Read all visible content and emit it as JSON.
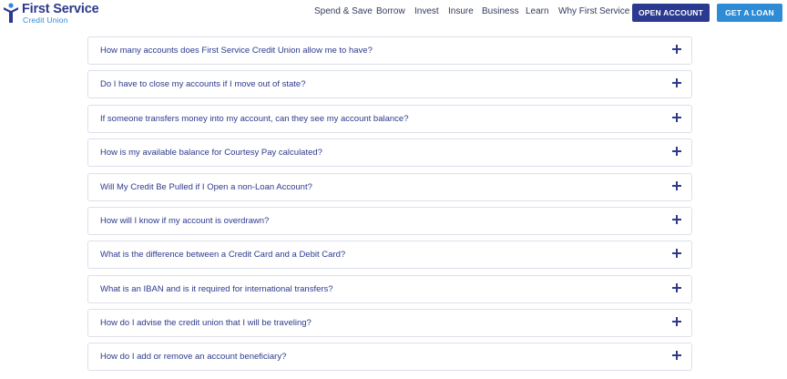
{
  "brand": {
    "name": "First Service",
    "subtitle": "Credit Union",
    "logo_icon": "person-arms-up-icon",
    "primary_color": "#2b3990",
    "accent_color": "#2e8bd6"
  },
  "nav": {
    "items": [
      "Spend & Save",
      "Borrow",
      "Invest",
      "Insure",
      "Business",
      "Learn",
      "Why First Service"
    ],
    "open_account_label": "OPEN ACCOUNT",
    "get_loan_label": "GET A LOAN"
  },
  "faq": {
    "expand_icon": "plus-icon",
    "items": [
      {
        "question": "How many accounts does First Service Credit Union allow me to have?"
      },
      {
        "question": "Do I have to close my accounts if I move out of state?"
      },
      {
        "question": "If someone transfers money into my account, can they see my account balance?"
      },
      {
        "question": "How is my available balance for Courtesy Pay calculated?"
      },
      {
        "question": "Will My Credit Be Pulled if I Open a non-Loan Account?"
      },
      {
        "question": "How will I know if my account is overdrawn?"
      },
      {
        "question": "What is the difference between a Credit Card and a Debit Card?"
      },
      {
        "question": "What is an IBAN and is it required for international transfers?"
      },
      {
        "question": "How do I advise the credit union that I will be traveling?"
      },
      {
        "question": "How do I add or remove an account beneficiary?"
      }
    ]
  }
}
